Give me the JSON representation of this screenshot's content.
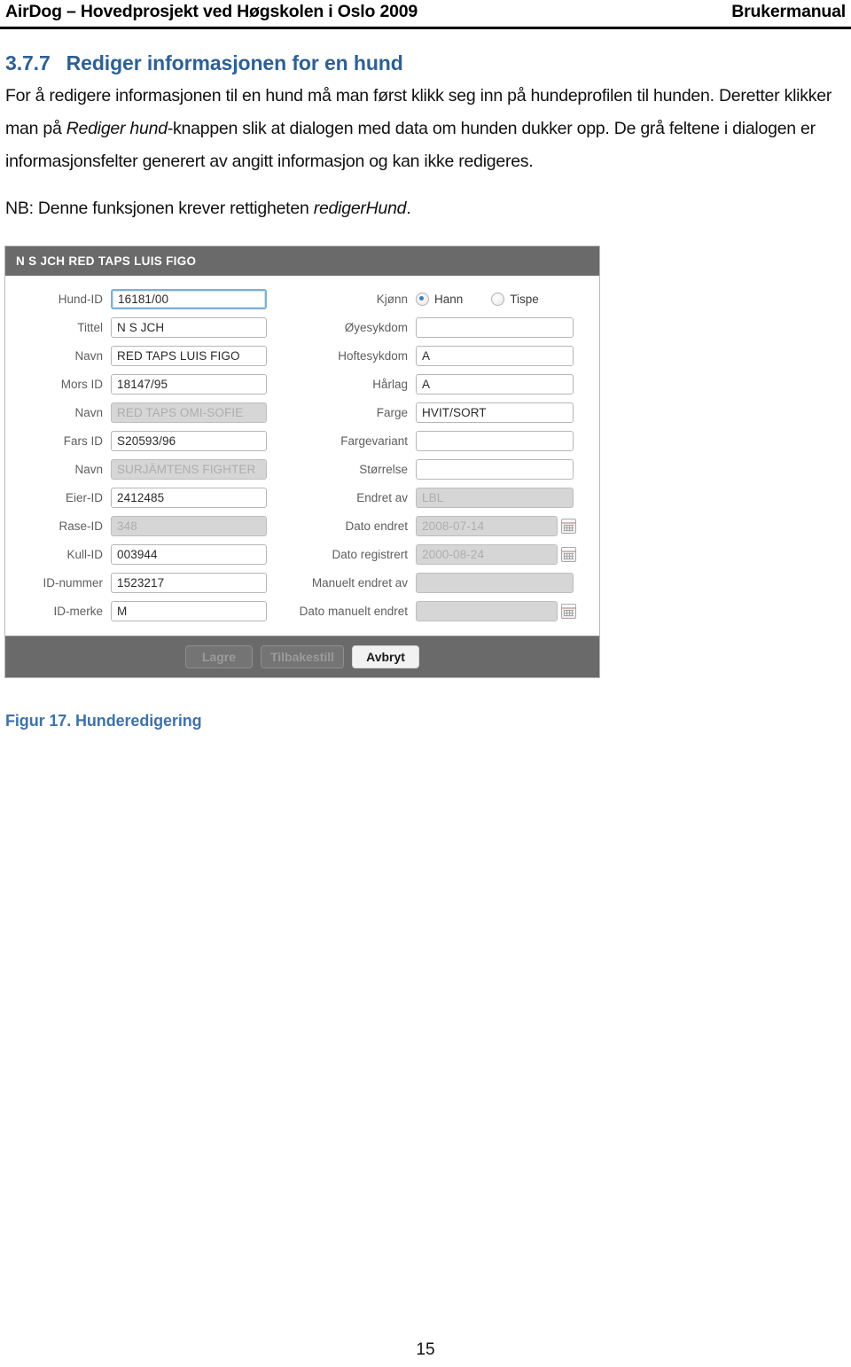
{
  "header": {
    "left": "AirDog – Hovedprosjekt ved Høgskolen i Oslo 2009",
    "right": "Brukermanual"
  },
  "section": {
    "number": "3.7.7",
    "title": "Rediger informasjonen for en hund",
    "paragraph_part1": "For å redigere informasjonen til en hund må man først klikk seg inn på hundeprofilen til hunden. Deretter klikker man på ",
    "paragraph_italic": "Rediger hund",
    "paragraph_part2": "-knappen slik at dialogen med data om hunden dukker opp. De grå feltene i dialogen er informasjonsfelter generert av angitt informasjon og kan ikke redigeres.",
    "nb_part1": "NB: Denne funksjonen krever rettigheten ",
    "nb_italic": "redigerHund",
    "nb_part2": "."
  },
  "dialog": {
    "title": "N S JCH RED TAPS LUIS FIGO",
    "left_fields": [
      {
        "label": "Hund-ID",
        "value": "16181/00",
        "disabled": false,
        "focused": true
      },
      {
        "label": "Tittel",
        "value": "N S JCH",
        "disabled": false,
        "focused": false
      },
      {
        "label": "Navn",
        "value": "RED TAPS LUIS FIGO",
        "disabled": false,
        "focused": false
      },
      {
        "label": "Mors ID",
        "value": "18147/95",
        "disabled": false,
        "focused": false
      },
      {
        "label": "Navn",
        "value": "RED TAPS OMI-SOFIE",
        "disabled": true,
        "focused": false
      },
      {
        "label": "Fars ID",
        "value": "S20593/96",
        "disabled": false,
        "focused": false
      },
      {
        "label": "Navn",
        "value": "SURJÄMTENS FIGHTER",
        "disabled": true,
        "focused": false
      },
      {
        "label": "Eier-ID",
        "value": "2412485",
        "disabled": false,
        "focused": false
      },
      {
        "label": "Rase-ID",
        "value": "348",
        "disabled": true,
        "focused": false
      },
      {
        "label": "Kull-ID",
        "value": "003944",
        "disabled": false,
        "focused": false
      },
      {
        "label": "ID-nummer",
        "value": "1523217",
        "disabled": false,
        "focused": false
      },
      {
        "label": "ID-merke",
        "value": "M",
        "disabled": false,
        "focused": false
      }
    ],
    "gender_row": {
      "label": "Kjønn",
      "options": [
        {
          "label": "Hann",
          "checked": true
        },
        {
          "label": "Tispe",
          "checked": false
        }
      ]
    },
    "right_fields": [
      {
        "label": "Øyesykdom",
        "value": "",
        "disabled": false,
        "calendar": false
      },
      {
        "label": "Hoftesykdom",
        "value": "A",
        "disabled": false,
        "calendar": false
      },
      {
        "label": "Hårlag",
        "value": "A",
        "disabled": false,
        "calendar": false
      },
      {
        "label": "Farge",
        "value": "HVIT/SORT",
        "disabled": false,
        "calendar": false
      },
      {
        "label": "Fargevariant",
        "value": "",
        "disabled": false,
        "calendar": false
      },
      {
        "label": "Størrelse",
        "value": "",
        "disabled": false,
        "calendar": false
      },
      {
        "label": "Endret av",
        "value": "LBL",
        "disabled": true,
        "calendar": false
      },
      {
        "label": "Dato endret",
        "value": "2008-07-14",
        "disabled": true,
        "calendar": true
      },
      {
        "label": "Dato registrert",
        "value": "2000-08-24",
        "disabled": true,
        "calendar": true
      },
      {
        "label": "Manuelt endret av",
        "value": "",
        "disabled": true,
        "calendar": false
      },
      {
        "label": "Dato manuelt endret",
        "value": "",
        "disabled": true,
        "calendar": true
      }
    ],
    "buttons": [
      {
        "label": "Lagre",
        "enabled": false
      },
      {
        "label": "Tilbakestill",
        "enabled": false
      },
      {
        "label": "Avbryt",
        "enabled": true
      }
    ]
  },
  "figure_caption": "Figur 17. Hunderedigering",
  "page_number": "15",
  "colors": {
    "heading_blue": "#2e6094",
    "caption_blue": "#3f72a8",
    "dialog_chrome": "#6a6a6a",
    "disabled_field": "#d6d6d6",
    "focus_border": "#7bb0d8",
    "radio_dot": "#3d7fc1"
  }
}
